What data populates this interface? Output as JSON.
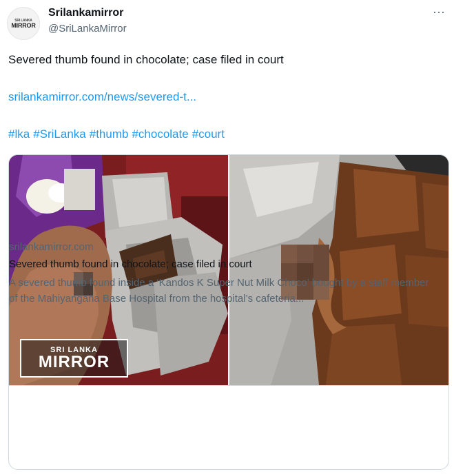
{
  "author": {
    "display_name": "Srilankamirror",
    "handle": "@SriLankaMirror",
    "avatar_logo": {
      "line1": "SRI LANKA",
      "line2": "MIRROR"
    }
  },
  "menu_icon": "more-horizontal-icon",
  "more_glyph": "···",
  "tweet": {
    "text": "Severed thumb found in chocolate; case filed in court",
    "link": "srilankamirror.com/news/severed-t...",
    "hashtags": [
      "#lka",
      "#SriLanka",
      "#thumb",
      "#chocolate",
      "#court"
    ]
  },
  "card": {
    "domain": "srilankamirror.com",
    "title": "Severed thumb found in chocolate; case filed in court",
    "description": "A severed thumb found inside a ‘Kandos K Super Nut Milk Choco’ bought by a staff member of the Mahiyangana Base Hospital from the hospital’s cafeteria...",
    "image_logo": {
      "top": "SRI LANKA",
      "main": "MIRROR"
    }
  },
  "colors": {
    "link": "#1d9bf0",
    "secondary_text": "#536471",
    "border": "#cfd9de"
  }
}
